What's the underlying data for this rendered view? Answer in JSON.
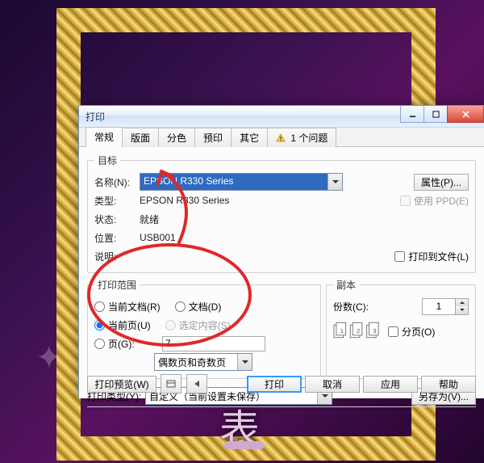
{
  "dialog": {
    "title": "打印"
  },
  "tabs": [
    "常规",
    "版面",
    "分色",
    "预印",
    "其它",
    "1 个问题"
  ],
  "target": {
    "legend": "目标",
    "name_label": "名称(N):",
    "printer_selected": "EPSON R330 Series",
    "properties_btn": "属性(P)...",
    "type_label": "类型:",
    "type_value": "EPSON R330 Series",
    "use_ppd_label": "使用 PPD(E)",
    "status_label": "状态:",
    "status_value": "就绪",
    "where_label": "位置:",
    "where_value": "USB001",
    "comment_label": "说明:",
    "print_to_file_label": "打印到文件(L)"
  },
  "range": {
    "legend": "打印范围",
    "current_doc": "当前文档(R)",
    "documents": "文档(D)",
    "current_page": "当前页(U)",
    "selection": "选定内容(S)",
    "pages": "页(G):",
    "pages_value": "7",
    "pages_mode": "偶数页和奇数页"
  },
  "copies": {
    "legend": "副本",
    "count_label": "份数(C):",
    "count_value": "1",
    "collate_label": "分页(O)"
  },
  "print_type": {
    "label": "打印类型(Y):",
    "value": "自定义（当前设置未保存）",
    "save_as_btn": "另存为(V)..."
  },
  "footer": {
    "preview_btn": "打印预览(W)",
    "print_btn": "打印",
    "cancel_btn": "取消",
    "apply_btn": "应用",
    "help_btn": "帮助"
  },
  "bg_char": "表"
}
